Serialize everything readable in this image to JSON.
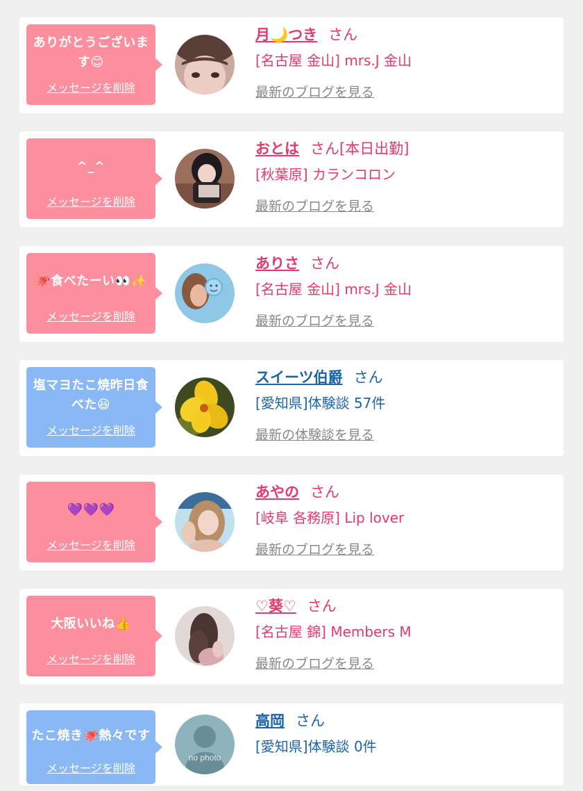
{
  "common": {
    "delete_label": "メッセージを削除",
    "honorific": "さん"
  },
  "colors": {
    "pink_bubble": "#fd8e9d",
    "blue_bubble": "#8ab8f5",
    "pink_text": "#e5386b",
    "blue_text": "#1e62a8",
    "gray_link": "#888888"
  },
  "entries": [
    {
      "message": "ありがとうございます😊",
      "name": "月🌙つき",
      "suffix": "",
      "shop": "[名古屋 金山] mrs.J 金山",
      "link": "最新のブログを見る",
      "theme": "pink"
    },
    {
      "message": "^_^",
      "name": "おとは",
      "suffix": "[本日出勤]",
      "shop": "[秋葉原] カランコロン",
      "link": "最新のブログを見る",
      "theme": "pink"
    },
    {
      "message": "🐙食べたーい👀✨",
      "name": "ありさ",
      "suffix": "",
      "shop": "[名古屋 金山] mrs.J 金山",
      "link": "最新のブログを見る",
      "theme": "pink"
    },
    {
      "message": "塩マヨたこ焼昨日食べた😆",
      "name": "スイーツ伯爵",
      "suffix": "",
      "shop": "[愛知県]体験談 57件",
      "link": "最新の体験談を見る",
      "theme": "blue"
    },
    {
      "message": "💜💜💜",
      "name": "あやの",
      "suffix": "",
      "shop": "[岐阜 各務原] Lip lover",
      "link": "最新のブログを見る",
      "theme": "pink"
    },
    {
      "message": "大阪いいね👍",
      "name": "♡葵♡",
      "suffix": "",
      "shop": "[名古屋 錦] Members M",
      "link": "最新のブログを見る",
      "theme": "pink"
    },
    {
      "message": "たこ焼き🐙熱々です",
      "name": "高岡",
      "suffix": "",
      "shop": "[愛知県]体験談 0件",
      "link": "",
      "theme": "blue",
      "avatar_caption": "no photo"
    }
  ]
}
